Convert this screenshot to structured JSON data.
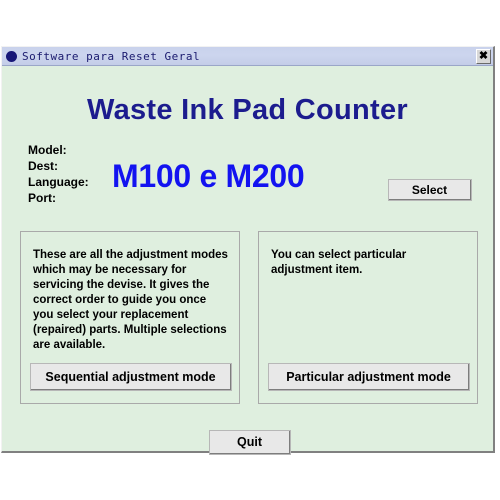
{
  "window": {
    "titlebar": {
      "icon": "app-circle-icon",
      "title": "Software para Reset Geral",
      "close_label": "✖"
    }
  },
  "main": {
    "heading": "Waste Ink Pad Counter",
    "info_fields": [
      {
        "label": "Model:",
        "value": ""
      },
      {
        "label": "Dest:",
        "value": ""
      },
      {
        "label": "Language:",
        "value": ""
      },
      {
        "label": "Port:",
        "value": ""
      }
    ],
    "model_display": "M100 e M200",
    "select_button": "Select",
    "panels": [
      {
        "id": "sequential",
        "description": "These are all the adjustment modes which may be necessary for servicing the devise. It gives the correct order to guide you once you select your replacement (repaired) parts. Multiple selections are available.",
        "button": "Sequential adjustment mode"
      },
      {
        "id": "particular",
        "description": "You can select particular adjustment item.",
        "button": "Particular adjustment mode"
      }
    ],
    "quit_button": "Quit"
  },
  "colors": {
    "window_background": "#dfefdf",
    "titlebar": "#ccd5ee",
    "heading_text": "#1c1c8e",
    "model_text": "#1313f0",
    "button_face": "#e8e8e8",
    "panel_border": "#a9a9a9"
  }
}
